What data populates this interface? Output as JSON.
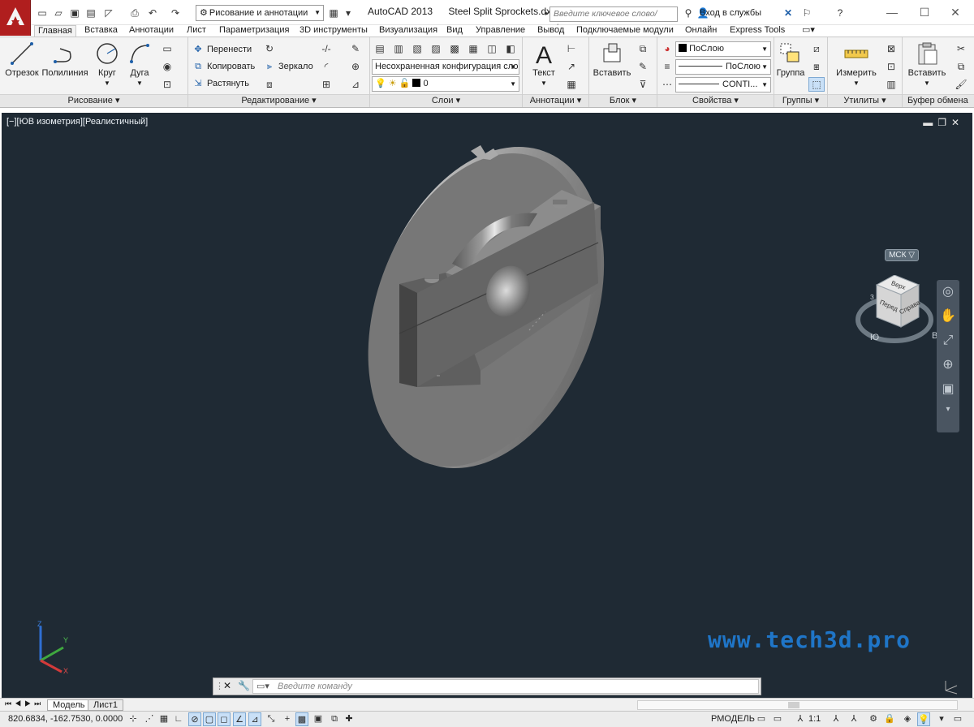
{
  "titlebar": {
    "workspace": "Рисование и аннотации",
    "app_name": "AutoCAD 2013",
    "file_name": "Steel Split Sprockets.dxf",
    "search_placeholder": "Введите ключевое слово/фразу",
    "login": "Вход в службы"
  },
  "tabs": [
    {
      "label": "Главная",
      "active": true
    },
    {
      "label": "Вставка"
    },
    {
      "label": "Аннотации"
    },
    {
      "label": "Лист"
    },
    {
      "label": "Параметризация"
    },
    {
      "label": "3D инструменты"
    },
    {
      "label": "Визуализация"
    },
    {
      "label": "Вид"
    },
    {
      "label": "Управление"
    },
    {
      "label": "Вывод"
    },
    {
      "label": "Подключаемые модули"
    },
    {
      "label": "Онлайн"
    },
    {
      "label": "Express Tools"
    }
  ],
  "ribbon": {
    "draw": {
      "title": "Рисование",
      "line": "Отрезок",
      "polyline": "Полилиния",
      "circle": "Круг",
      "arc": "Дуга"
    },
    "modify": {
      "title": "Редактирование",
      "move": "Перенести",
      "copy": "Копировать",
      "stretch": "Растянуть",
      "mirror": "Зеркало"
    },
    "layers": {
      "title": "Слои",
      "layer_state": "Несохраненная конфигурация сло",
      "current_layer": "0"
    },
    "annotation": {
      "title": "Аннотации",
      "text": "Текст"
    },
    "block": {
      "title": "Блок",
      "insert": "Вставить"
    },
    "properties": {
      "title": "Свойства",
      "color": "ПоСлою",
      "lineweight": "ПоСлою",
      "linetype": "CONTI..."
    },
    "groups": {
      "title": "Группы",
      "group": "Группа"
    },
    "utilities": {
      "title": "Утилиты",
      "measure": "Измерить"
    },
    "clipboard": {
      "title": "Буфер обмена",
      "paste": "Вставить"
    }
  },
  "viewport": {
    "label": "[−][ЮВ изометрия][Реалистичный]",
    "viewcube": {
      "top": "Верх",
      "front": "Перед",
      "right": "Справа",
      "south": "Ю",
      "east": "В",
      "west": "З"
    },
    "wcs": "МСК",
    "watermark": "www.tech3d.pro",
    "ucs": {
      "x": "X",
      "y": "Y",
      "z": "Z"
    }
  },
  "command": {
    "placeholder": "Введите команду"
  },
  "layout_tabs": [
    {
      "label": "Модель"
    },
    {
      "label": "Лист1"
    }
  ],
  "status": {
    "coords": "820.6834, -162.7530, 0.0000",
    "space": "РМОДЕЛЬ",
    "scale": "1:1"
  }
}
